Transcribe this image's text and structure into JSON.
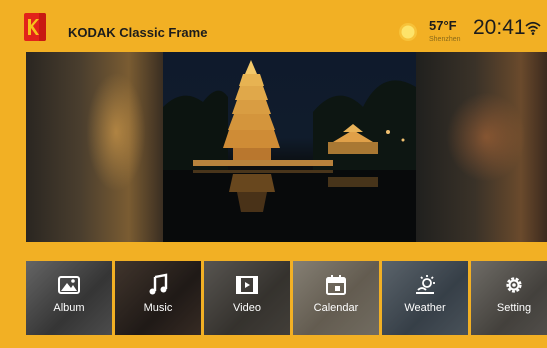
{
  "header": {
    "brand": "KODAK Classic Frame",
    "logo_text": "KODAK",
    "temperature": "57°F",
    "city": "Shenzhen",
    "time": "20:41"
  },
  "icons": {
    "weather": "sun-icon",
    "status": "wifi-icon"
  },
  "menu": [
    {
      "label": "Album",
      "icon": "image-icon"
    },
    {
      "label": "Music",
      "icon": "music-note-icon"
    },
    {
      "label": "Video",
      "icon": "film-icon"
    },
    {
      "label": "Calendar",
      "icon": "calendar-icon"
    },
    {
      "label": "Weather",
      "icon": "weather-icon"
    },
    {
      "label": "Setting",
      "icon": "gear-icon"
    }
  ],
  "colors": {
    "background": "#f2b024",
    "brand_red": "#e2231a",
    "text": "#1c1c1c"
  }
}
